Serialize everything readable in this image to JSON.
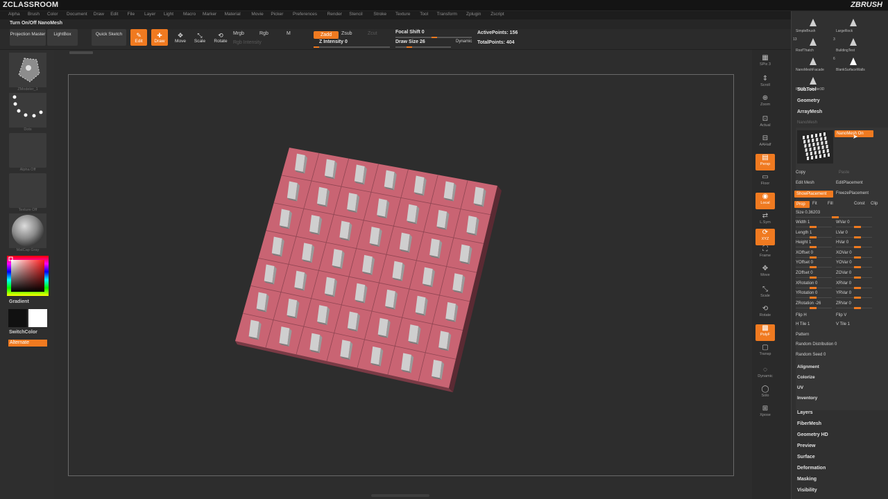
{
  "app": {
    "brand_left": "ZCLASSROOM",
    "brand_right": "ZBRUSH"
  },
  "menu": [
    "Alpha",
    "Brush",
    "Color",
    "Document",
    "Draw",
    "Edit",
    "File",
    "Layer",
    "Light",
    "Macro",
    "Marker",
    "Material",
    "Movie",
    "Picker",
    "Preferences",
    "Render",
    "Stencil",
    "Stroke",
    "Texture",
    "Tool",
    "Transform",
    "Zplugin",
    "Zscript"
  ],
  "tooltip": "Turn On/Off NanoMesh",
  "toolbar": {
    "projection_master": "Projection Master",
    "lightbox": "LightBox",
    "quick_sketch": "Quick Sketch",
    "edit": "Edit",
    "draw": "Draw",
    "move": "Move",
    "scale": "Scale",
    "rotate": "Rotate",
    "mrgb": "Mrgb",
    "rgb": "Rgb",
    "m": "M",
    "rgb_intensity": "Rgb Intensity",
    "zadd": "Zadd",
    "zsub": "Zsub",
    "zcut": "Zcut",
    "z_intensity": "Z Intensity 0",
    "focal_shift": "Focal Shift 0",
    "draw_size": "Draw Size 26",
    "dynamic": "Dynamic",
    "active_points": "ActivePoints: 156",
    "total_points": "TotalPoints: 404"
  },
  "left_shelf": {
    "brush_caption": "ZModeler_1",
    "stroke_caption": "Dots",
    "alpha_caption": "Alpha Off",
    "texture_caption": "Texture Off",
    "material_caption": "MatCap Gray",
    "gradient": "Gradient",
    "switch_color": "SwitchColor",
    "alternate": "Alternate",
    "primary_color": "#111111",
    "secondary_color": "#ffffff"
  },
  "right_shelf": [
    {
      "name": "spix",
      "label": "SPix 3",
      "on": false
    },
    {
      "name": "scroll",
      "label": "Scroll",
      "on": false
    },
    {
      "name": "zoom",
      "label": "Zoom",
      "on": false
    },
    {
      "name": "actual",
      "label": "Actual",
      "on": false
    },
    {
      "name": "aahalf",
      "label": "AAHalf",
      "on": false
    },
    {
      "name": "persp",
      "label": "Persp",
      "on": true
    },
    {
      "name": "floor",
      "label": "Floor",
      "on": false
    },
    {
      "name": "local",
      "label": "Local",
      "on": true
    },
    {
      "name": "lsym",
      "label": "L.Sym",
      "on": false
    },
    {
      "name": "xyz",
      "label": "XYZ",
      "on": true
    },
    {
      "name": "frame",
      "label": "Frame",
      "on": false
    },
    {
      "name": "move",
      "label": "Move",
      "on": false
    },
    {
      "name": "scale",
      "label": "Scale",
      "on": false
    },
    {
      "name": "rotate",
      "label": "Rotate",
      "on": false
    },
    {
      "name": "polyf",
      "label": "PolyF",
      "on": true
    },
    {
      "name": "transp",
      "label": "Transp",
      "on": false
    },
    {
      "name": "dynamic",
      "label": "Dynamic",
      "on": false
    },
    {
      "name": "solo",
      "label": "Solo",
      "on": false
    },
    {
      "name": "xpose",
      "label": "Xpose",
      "on": false
    }
  ],
  "tray": {
    "tools": [
      {
        "name": "SimpleBrush",
        "count": ""
      },
      {
        "name": "LargeRock",
        "count": ""
      },
      {
        "name": "RoofThatch",
        "count": "13"
      },
      {
        "name": "BuildingTest",
        "count": "3"
      },
      {
        "name": "NanoMeshFacade",
        "count": ""
      },
      {
        "name": "BlankSurfaceWalls",
        "count": "6"
      },
      {
        "name": "PM3D_Cylinder3D",
        "count": ""
      }
    ],
    "sections_top": [
      "SubTool",
      "Geometry",
      "ArrayMesh"
    ],
    "nanomesh_title": "NanoMesh",
    "nanomesh_on": "NanoMesh On",
    "copy": "Copy",
    "paste": "Paste",
    "edit_mesh": "Edit Mesh",
    "edit_placement": "EditPlacement",
    "show_placement": "ShowPlacement",
    "freeze_placement": "FreezePlacement",
    "prop": "Prop",
    "fit": "Fit",
    "fill": "Fill",
    "const": "Const",
    "clip": "Clip",
    "size": "Size 0.36203",
    "params_left": [
      "Width 1",
      "Length 1",
      "Height 1",
      "XOffset 0",
      "YOffset 0",
      "ZOffset 0",
      "XRotation 0",
      "YRotation 0",
      "ZRotation -26"
    ],
    "params_right": [
      "WVar 0",
      "LVar 0",
      "HVar 0",
      "XOVar 0",
      "YOVar 0",
      "ZOVar 0",
      "XRVar 0",
      "YRVar 0",
      "ZRVar 0"
    ],
    "flip_h": "Flip H",
    "flip_v": "Flip V",
    "h_tile": "H Tile 1",
    "v_tile": "V Tile 1",
    "pattern": "Pattern",
    "random_distribution": "Random Distribution 0",
    "random_seed": "Random Seed 0",
    "sub_sections": [
      "Alignment",
      "Colorize",
      "UV",
      "Inventory"
    ],
    "sections_bottom": [
      "Layers",
      "FiberMesh",
      "Geometry HD",
      "Preview",
      "Surface",
      "Deformation",
      "Masking",
      "Visibility"
    ]
  },
  "mesh": {
    "rows": 7,
    "cols": 7,
    "plate_color": "#c96473",
    "block_color": "#cfcfcf"
  }
}
